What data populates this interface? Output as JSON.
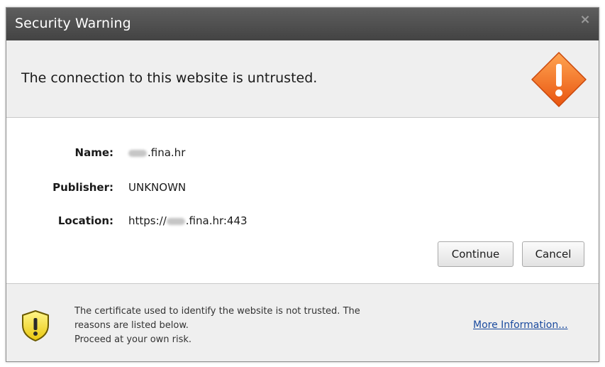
{
  "window": {
    "title": "Security Warning",
    "close_glyph": "×"
  },
  "header": {
    "message": "The connection to this website is untrusted.",
    "icon": "warning-diamond-icon",
    "icon_color": "#f26522"
  },
  "details": {
    "name_label": "Name:",
    "name_value": ".fina.hr",
    "publisher_label": "Publisher:",
    "publisher_value": "UNKNOWN",
    "location_label": "Location:",
    "location_prefix": "https://",
    "location_value": ".fina.hr:443"
  },
  "buttons": {
    "continue_label": "Continue",
    "cancel_label": "Cancel"
  },
  "footer": {
    "icon": "shield-warning-icon",
    "icon_color": "#f5e22a",
    "line1": "The certificate used to identify the website is not trusted.  The",
    "line2": "reasons are listed below.",
    "line3": "Proceed at your own risk.",
    "more_info_label": "More Information..."
  }
}
